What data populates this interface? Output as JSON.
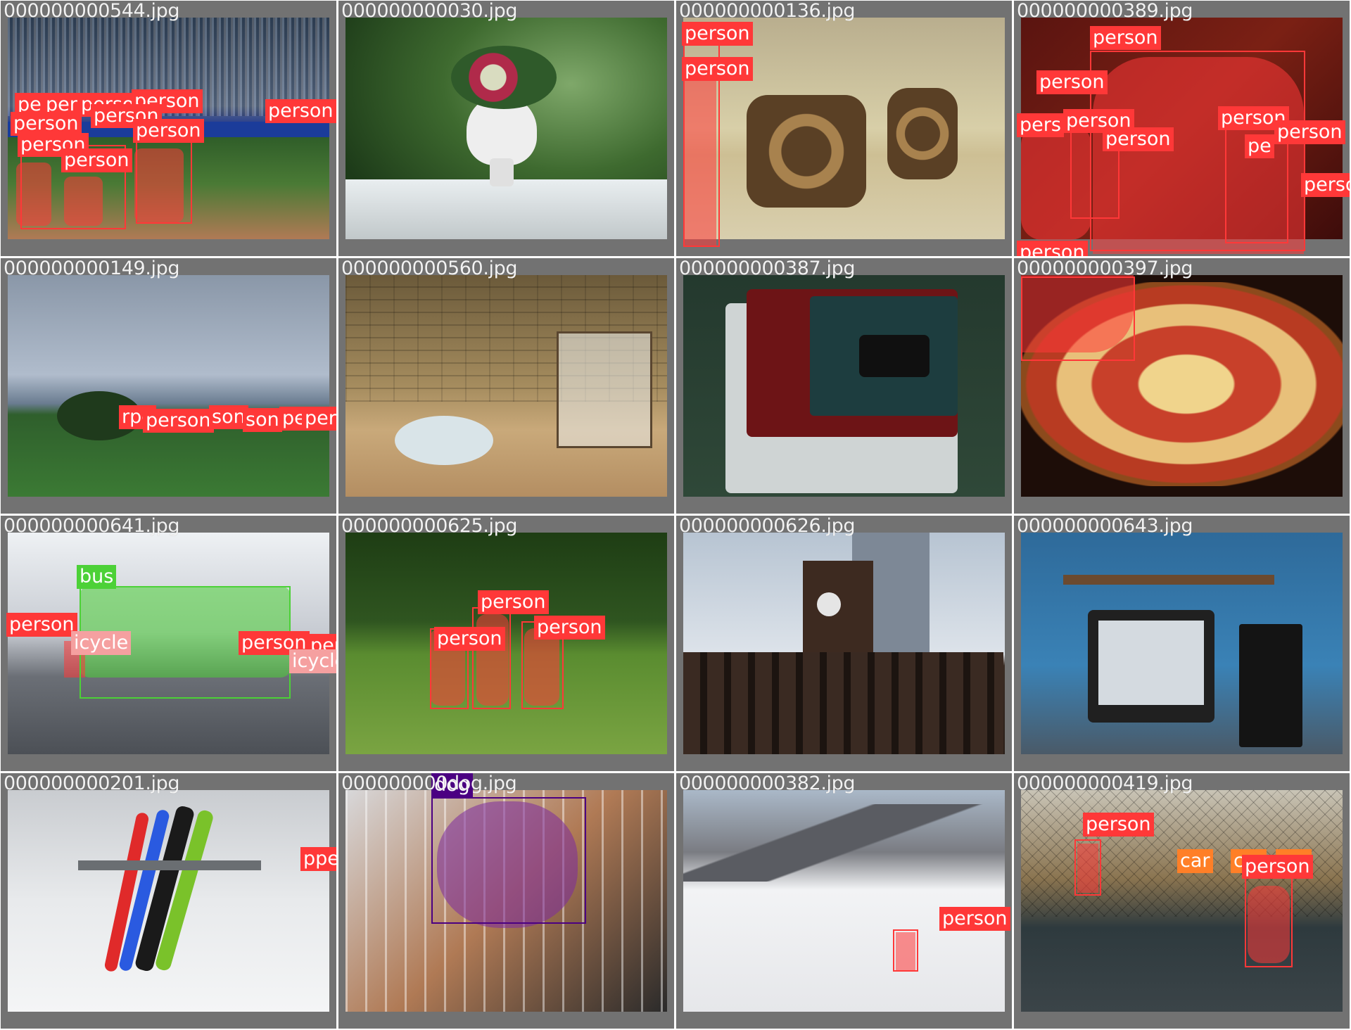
{
  "colors": {
    "person": "#ff3838",
    "bus": "#4cd137",
    "bicycle": "#f5a0a0",
    "dog": "#4b0082",
    "car": "#ff7f27",
    "tile_bg": "#727272",
    "filename_text": "#f2f2f2"
  },
  "tiles": [
    {
      "filename": "000000000544.jpg",
      "scene": "baseball",
      "labels": [
        "per",
        "per",
        "person",
        "person",
        "person",
        "person",
        "person",
        "person",
        "person",
        "person"
      ]
    },
    {
      "filename": "000000000030.jpg",
      "scene": "vase",
      "labels": []
    },
    {
      "filename": "000000000136.jpg",
      "scene": "giraffe",
      "labels": [
        "person",
        "person"
      ]
    },
    {
      "filename": "000000000389.jpg",
      "scene": "crowd",
      "labels": [
        "person",
        "person",
        "pers",
        "person",
        "person",
        "person",
        "person",
        "pe",
        "perso",
        "person"
      ]
    },
    {
      "filename": "000000000149.jpg",
      "scene": "field",
      "labels": [
        "rpe",
        "person",
        "son",
        "son",
        "pe",
        "person"
      ]
    },
    {
      "filename": "000000000560.jpg",
      "scene": "bathroom",
      "labels": []
    },
    {
      "filename": "000000000387.jpg",
      "scene": "laptop",
      "labels": []
    },
    {
      "filename": "000000000397.jpg",
      "scene": "pizza",
      "labels": []
    },
    {
      "filename": "000000000641.jpg",
      "scene": "bus",
      "labels": [
        "bus",
        "person",
        "icycle",
        "person",
        "person",
        "icycle"
      ]
    },
    {
      "filename": "000000000625.jpg",
      "scene": "frisbee",
      "labels": [
        "person",
        "person",
        "person"
      ]
    },
    {
      "filename": "000000000626.jpg",
      "scene": "tower",
      "labels": []
    },
    {
      "filename": "000000000643.jpg",
      "scene": "desk",
      "labels": []
    },
    {
      "filename": "000000000201.jpg",
      "scene": "snowboards",
      "labels": [
        "pperson"
      ]
    },
    {
      "filename": "000000000dog.jpg",
      "scene": "basket",
      "labels": [
        "dog"
      ]
    },
    {
      "filename": "000000000382.jpg",
      "scene": "mountain",
      "labels": [
        "person"
      ]
    },
    {
      "filename": "000000000419.jpg",
      "scene": "tennis",
      "labels": [
        "person",
        "car",
        "car",
        "car",
        "person"
      ]
    }
  ]
}
